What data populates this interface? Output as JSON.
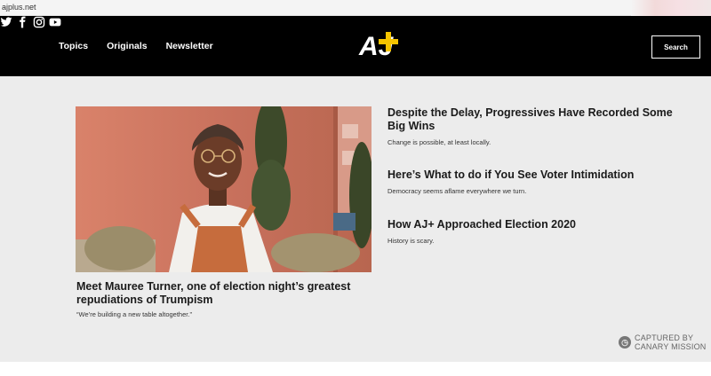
{
  "browser": {
    "url": "ajplus.net"
  },
  "header": {
    "nav": [
      "Topics",
      "Originals",
      "Newsletter"
    ],
    "logo_text": "AJ+",
    "social_icons": [
      "twitter-icon",
      "facebook-icon",
      "instagram-icon",
      "youtube-icon"
    ],
    "search_label": "Search",
    "colors": {
      "background": "#000000",
      "logo_accent": "#f5c400"
    }
  },
  "feature": {
    "title": "Meet Mauree Turner, one of election night’s greatest repudiations of Trumpism",
    "subtitle": "“We’re building a new table altogether.”"
  },
  "articles": [
    {
      "title": "Despite the Delay, Progressives Have Recorded Some Big Wins",
      "subtitle": "Change is possible, at least locally."
    },
    {
      "title": "Here’s What to do if You See Voter Intimidation",
      "subtitle": "Democracy seems aflame everywhere we turn."
    },
    {
      "title": "How AJ+ Approached Election 2020",
      "subtitle": "History is scary."
    }
  ],
  "watermark": {
    "line1": "CAPTURED BY",
    "line2": "CANARY MISSION"
  }
}
